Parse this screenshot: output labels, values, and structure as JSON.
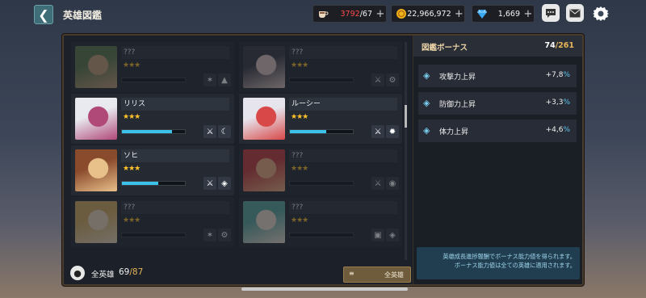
{
  "header": {
    "back_icon": "back-arrow-icon",
    "title": "英雄図鑑"
  },
  "resources": [
    {
      "icon": "coffee-cup-icon",
      "current": "3792",
      "max": "/67",
      "current_color": "#ff4a4a"
    },
    {
      "icon": "gold-coin-icon",
      "value": "22,966,972"
    },
    {
      "icon": "blue-gem-icon",
      "value": "1,669"
    }
  ],
  "top_buttons": [
    "chat-icon",
    "mail-icon",
    "gear-icon"
  ],
  "heroes": [
    {
      "name": "???",
      "stars": "★★★",
      "progress": 0,
      "owned": false,
      "skills": [
        "wing-icon",
        "mountain-icon"
      ],
      "palette": [
        "#5c7a4c",
        "#c8a078"
      ]
    },
    {
      "name": "???",
      "stars": "★★★",
      "progress": 0,
      "owned": false,
      "skills": [
        "crossed-swords-icon",
        "gear-icon"
      ],
      "palette": [
        "#3a3a44",
        "#e0c8c0"
      ]
    },
    {
      "name": "リリス",
      "stars": "★★★",
      "progress": 0.8,
      "owned": true,
      "skills": [
        "crossed-swords-icon",
        "moon-icon"
      ],
      "palette": [
        "#e8eaf0",
        "#b04878"
      ]
    },
    {
      "name": "ルーシー",
      "stars": "★★★",
      "progress": 0.58,
      "owned": true,
      "skills": [
        "crossed-swords-icon",
        "flame-icon"
      ],
      "palette": [
        "#e6e4ec",
        "#d84848"
      ]
    },
    {
      "name": "ソヒ",
      "stars": "★★★",
      "progress": 0.58,
      "owned": true,
      "skills": [
        "crossed-swords-icon",
        "diamond-icon"
      ],
      "palette": [
        "#8a4a2c",
        "#e8c08a"
      ]
    },
    {
      "name": "???",
      "stars": "★★★",
      "progress": 0,
      "owned": false,
      "skills": [
        "crossed-swords-icon",
        "drop-icon"
      ],
      "palette": [
        "#c83c3c",
        "#f0b080"
      ]
    },
    {
      "name": "???",
      "stars": "★★★",
      "progress": 0,
      "owned": false,
      "skills": [
        "wing-icon",
        "gear-icon"
      ],
      "palette": [
        "#d8b060",
        "#f0dcc0"
      ]
    },
    {
      "name": "???",
      "stars": "★★★",
      "progress": 0,
      "owned": false,
      "skills": [
        "shield-icon",
        "diamond-icon"
      ],
      "palette": [
        "#5aa8a0",
        "#f0e0d0"
      ]
    }
  ],
  "bottom": {
    "icon": "hero-badge-icon",
    "label": "全英雄",
    "owned": "69",
    "total": "/87",
    "filter_icon": "filter-list-icon",
    "filter_label": "全英雄"
  },
  "panel": {
    "title": "図鑑ボーナス",
    "count_current": "74",
    "count_total": "/261",
    "bonuses": [
      {
        "icon": "diamond-stat-icon",
        "name": "攻撃力上昇",
        "value": "+7,8",
        "unit": "%"
      },
      {
        "icon": "diamond-stat-icon",
        "name": "防御力上昇",
        "value": "+3,3",
        "unit": "%"
      },
      {
        "icon": "diamond-stat-icon",
        "name": "体力上昇",
        "value": "+4,6",
        "unit": "%"
      }
    ],
    "note_line1": "英雄成長進捗報酬でボーナス能力値を得られます。",
    "note_line2": "ボーナス能力値は全ての英雄に適用されます。"
  },
  "colors": {
    "accent_gold": "#e6b45a",
    "bonus_blue": "#5ec6f0",
    "progress": "#3cc2e8",
    "stars": "#ffc42a"
  }
}
